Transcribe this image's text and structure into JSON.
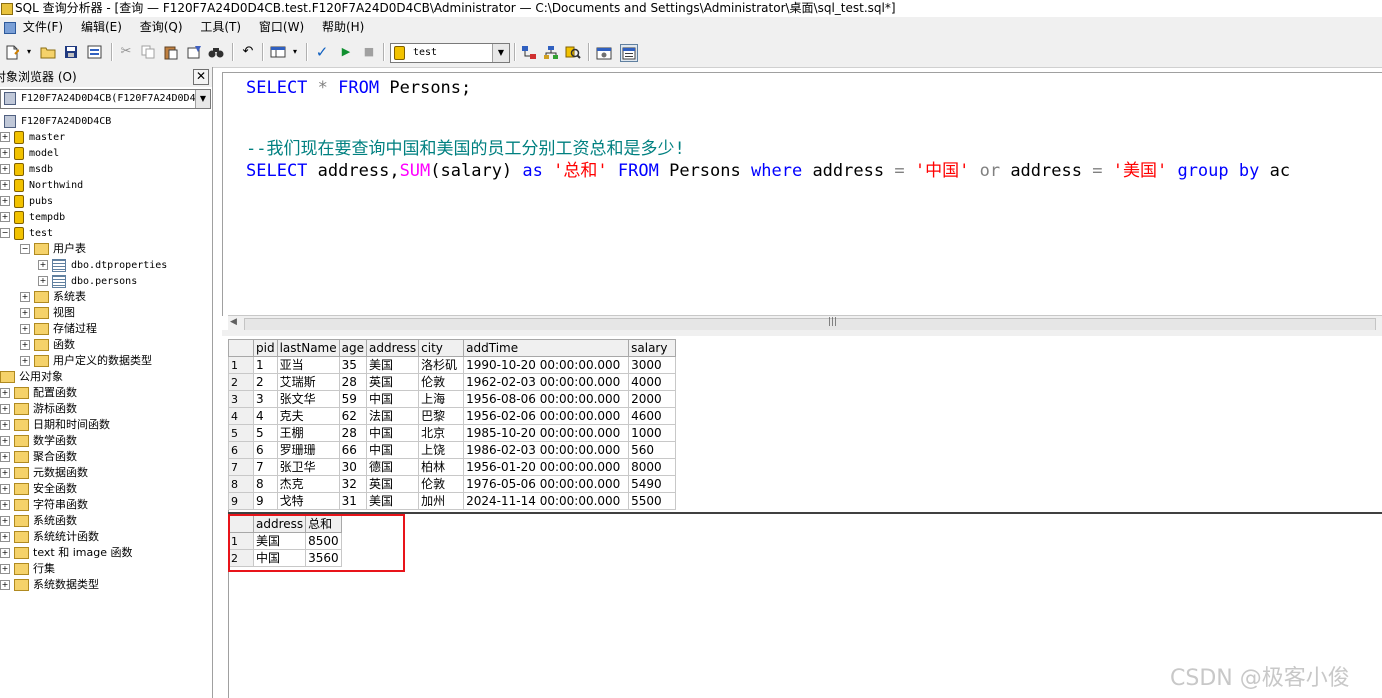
{
  "window": {
    "title": "SQL 查询分析器 - [查询 — F120F7A24D0D4CB.test.F120F7A24D0D4CB\\Administrator — C:\\Documents and Settings\\Administrator\\桌面\\sql_test.sql*]"
  },
  "menu": {
    "items": [
      "文件(F)",
      "编辑(E)",
      "查询(Q)",
      "工具(T)",
      "窗口(W)",
      "帮助(H)"
    ]
  },
  "toolbar": {
    "database": "test"
  },
  "object_browser": {
    "title": "对象浏览器 (O)",
    "close_label": "✕",
    "server_combo": "F120F7A24D0D4CB(F120F7A24D0D4C",
    "server": "F120F7A24D0D4CB",
    "databases": [
      "master",
      "model",
      "msdb",
      "Northwind",
      "pubs",
      "tempdb",
      "test"
    ],
    "test_children": {
      "user_tables": "用户表",
      "tables": [
        "dbo.dtproperties",
        "dbo.persons"
      ],
      "others": [
        "系统表",
        "视图",
        "存储过程",
        "函数",
        "用户定义的数据类型"
      ]
    },
    "public_objects": "公用对象",
    "public_children": [
      "配置函数",
      "游标函数",
      "日期和时间函数",
      "数学函数",
      "聚合函数",
      "元数据函数",
      "安全函数",
      "字符串函数",
      "系统函数",
      "系统统计函数",
      "text 和 image 函数",
      "行集",
      "系统数据类型"
    ]
  },
  "editor": {
    "line1": {
      "k1": "SELECT",
      "op": "*",
      "k2": "FROM",
      "t": "Persons;"
    },
    "comment": "--我们现在要查询中国和美国的员工分别工资总和是多少!",
    "line3": {
      "k1": "SELECT",
      "t1": "address,",
      "fn": "SUM",
      "t2": "(salary)",
      "k2": "as",
      "s1": "'总和'",
      "k3": "FROM",
      "t3": "Persons",
      "k4": "where",
      "t4": "address",
      "op1": "=",
      "s2": "'中国'",
      "op2": "or",
      "t5": "address",
      "op3": "=",
      "s3": "'美国'",
      "k5": "group by",
      "t6": "ac"
    }
  },
  "results1": {
    "columns": [
      "pid",
      "lastName",
      "age",
      "address",
      "city",
      "addTime",
      "salary"
    ],
    "rows": [
      [
        "1",
        "1",
        "亚当",
        "35",
        "美国",
        "洛杉矶",
        "1990-10-20 00:00:00.000",
        "3000"
      ],
      [
        "2",
        "2",
        "艾瑞斯",
        "28",
        "英国",
        "伦敦",
        "1962-02-03 00:00:00.000",
        "4000"
      ],
      [
        "3",
        "3",
        "张文华",
        "59",
        "中国",
        "上海",
        "1956-08-06 00:00:00.000",
        "2000"
      ],
      [
        "4",
        "4",
        "克夫",
        "62",
        "法国",
        "巴黎",
        "1956-02-06 00:00:00.000",
        "4600"
      ],
      [
        "5",
        "5",
        "王棚",
        "28",
        "中国",
        "北京",
        "1985-10-20 00:00:00.000",
        "1000"
      ],
      [
        "6",
        "6",
        "罗珊珊",
        "66",
        "中国",
        "上饶",
        "1986-02-03 00:00:00.000",
        "560"
      ],
      [
        "7",
        "7",
        "张卫华",
        "30",
        "德国",
        "柏林",
        "1956-01-20 00:00:00.000",
        "8000"
      ],
      [
        "8",
        "8",
        "杰克",
        "32",
        "英国",
        "伦敦",
        "1976-05-06 00:00:00.000",
        "5490"
      ],
      [
        "9",
        "9",
        "戈特",
        "31",
        "美国",
        "加州",
        "2024-11-14 00:00:00.000",
        "5500"
      ]
    ]
  },
  "results2": {
    "columns": [
      "address",
      "总和"
    ],
    "rows": [
      [
        "1",
        "美国",
        "8500"
      ],
      [
        "2",
        "中国",
        "3560"
      ]
    ]
  },
  "watermark": "CSDN @极客小俊"
}
